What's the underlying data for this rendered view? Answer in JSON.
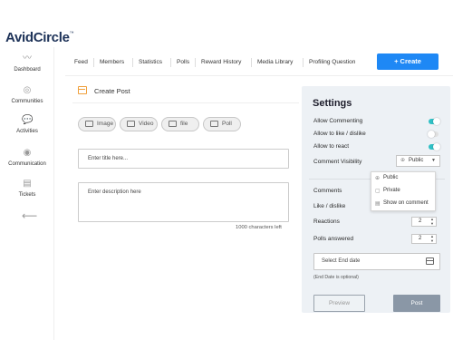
{
  "brand": {
    "name": "AvidCircle",
    "tm": "™"
  },
  "sidebar": {
    "items": [
      {
        "label": "Dashboard",
        "icon": "activity-wave-icon",
        "glyph": "〰"
      },
      {
        "label": "Communities",
        "icon": "community-circle-icon",
        "glyph": "◎"
      },
      {
        "label": "Activities",
        "icon": "chat-bubble-icon",
        "glyph": "💬"
      },
      {
        "label": "Communication",
        "icon": "broadcast-icon",
        "glyph": "◉"
      },
      {
        "label": "Tickets",
        "icon": "ticket-icon",
        "glyph": "▤"
      },
      {
        "label": "",
        "icon": "logout-arrow-icon",
        "glyph": "⟵"
      }
    ]
  },
  "nav": {
    "tabs": [
      "Feed",
      "Members",
      "Statistics",
      "Polls",
      "Reward History",
      "Media Library",
      "Profiling Question"
    ],
    "create_label": "+ Create"
  },
  "post": {
    "title": "Create Post",
    "media_buttons": [
      "Image",
      "Video",
      "file",
      "Poll"
    ],
    "title_placeholder": "Enter title here...",
    "desc_placeholder": "Enter description here",
    "char_count": "1000 characters left"
  },
  "settings": {
    "title": "Settings",
    "toggles": [
      {
        "label": "Allow Commenting",
        "on": true
      },
      {
        "label": "Allow to like / dislike",
        "on": false
      },
      {
        "label": "Allow to react",
        "on": true
      }
    ],
    "comment_visibility": {
      "label": "Comment Visibility",
      "value": "Public",
      "options": [
        "Public",
        "Private",
        "Show on comment"
      ]
    },
    "counters": [
      {
        "label": "Comments",
        "value": ""
      },
      {
        "label": "Like / dislike",
        "value": ""
      },
      {
        "label": "Reactions",
        "value": "2"
      },
      {
        "label": "Polls answered",
        "value": "2"
      }
    ],
    "end_date_placeholder": "Select End date",
    "end_date_note": "(End Date is optional)",
    "preview_label": "Preview",
    "post_label": "Post"
  },
  "colors": {
    "accent": "#1e88f5",
    "toggle_on": "#30c0c5",
    "brand": "#1d3258",
    "post_button": "#8a97a6"
  }
}
